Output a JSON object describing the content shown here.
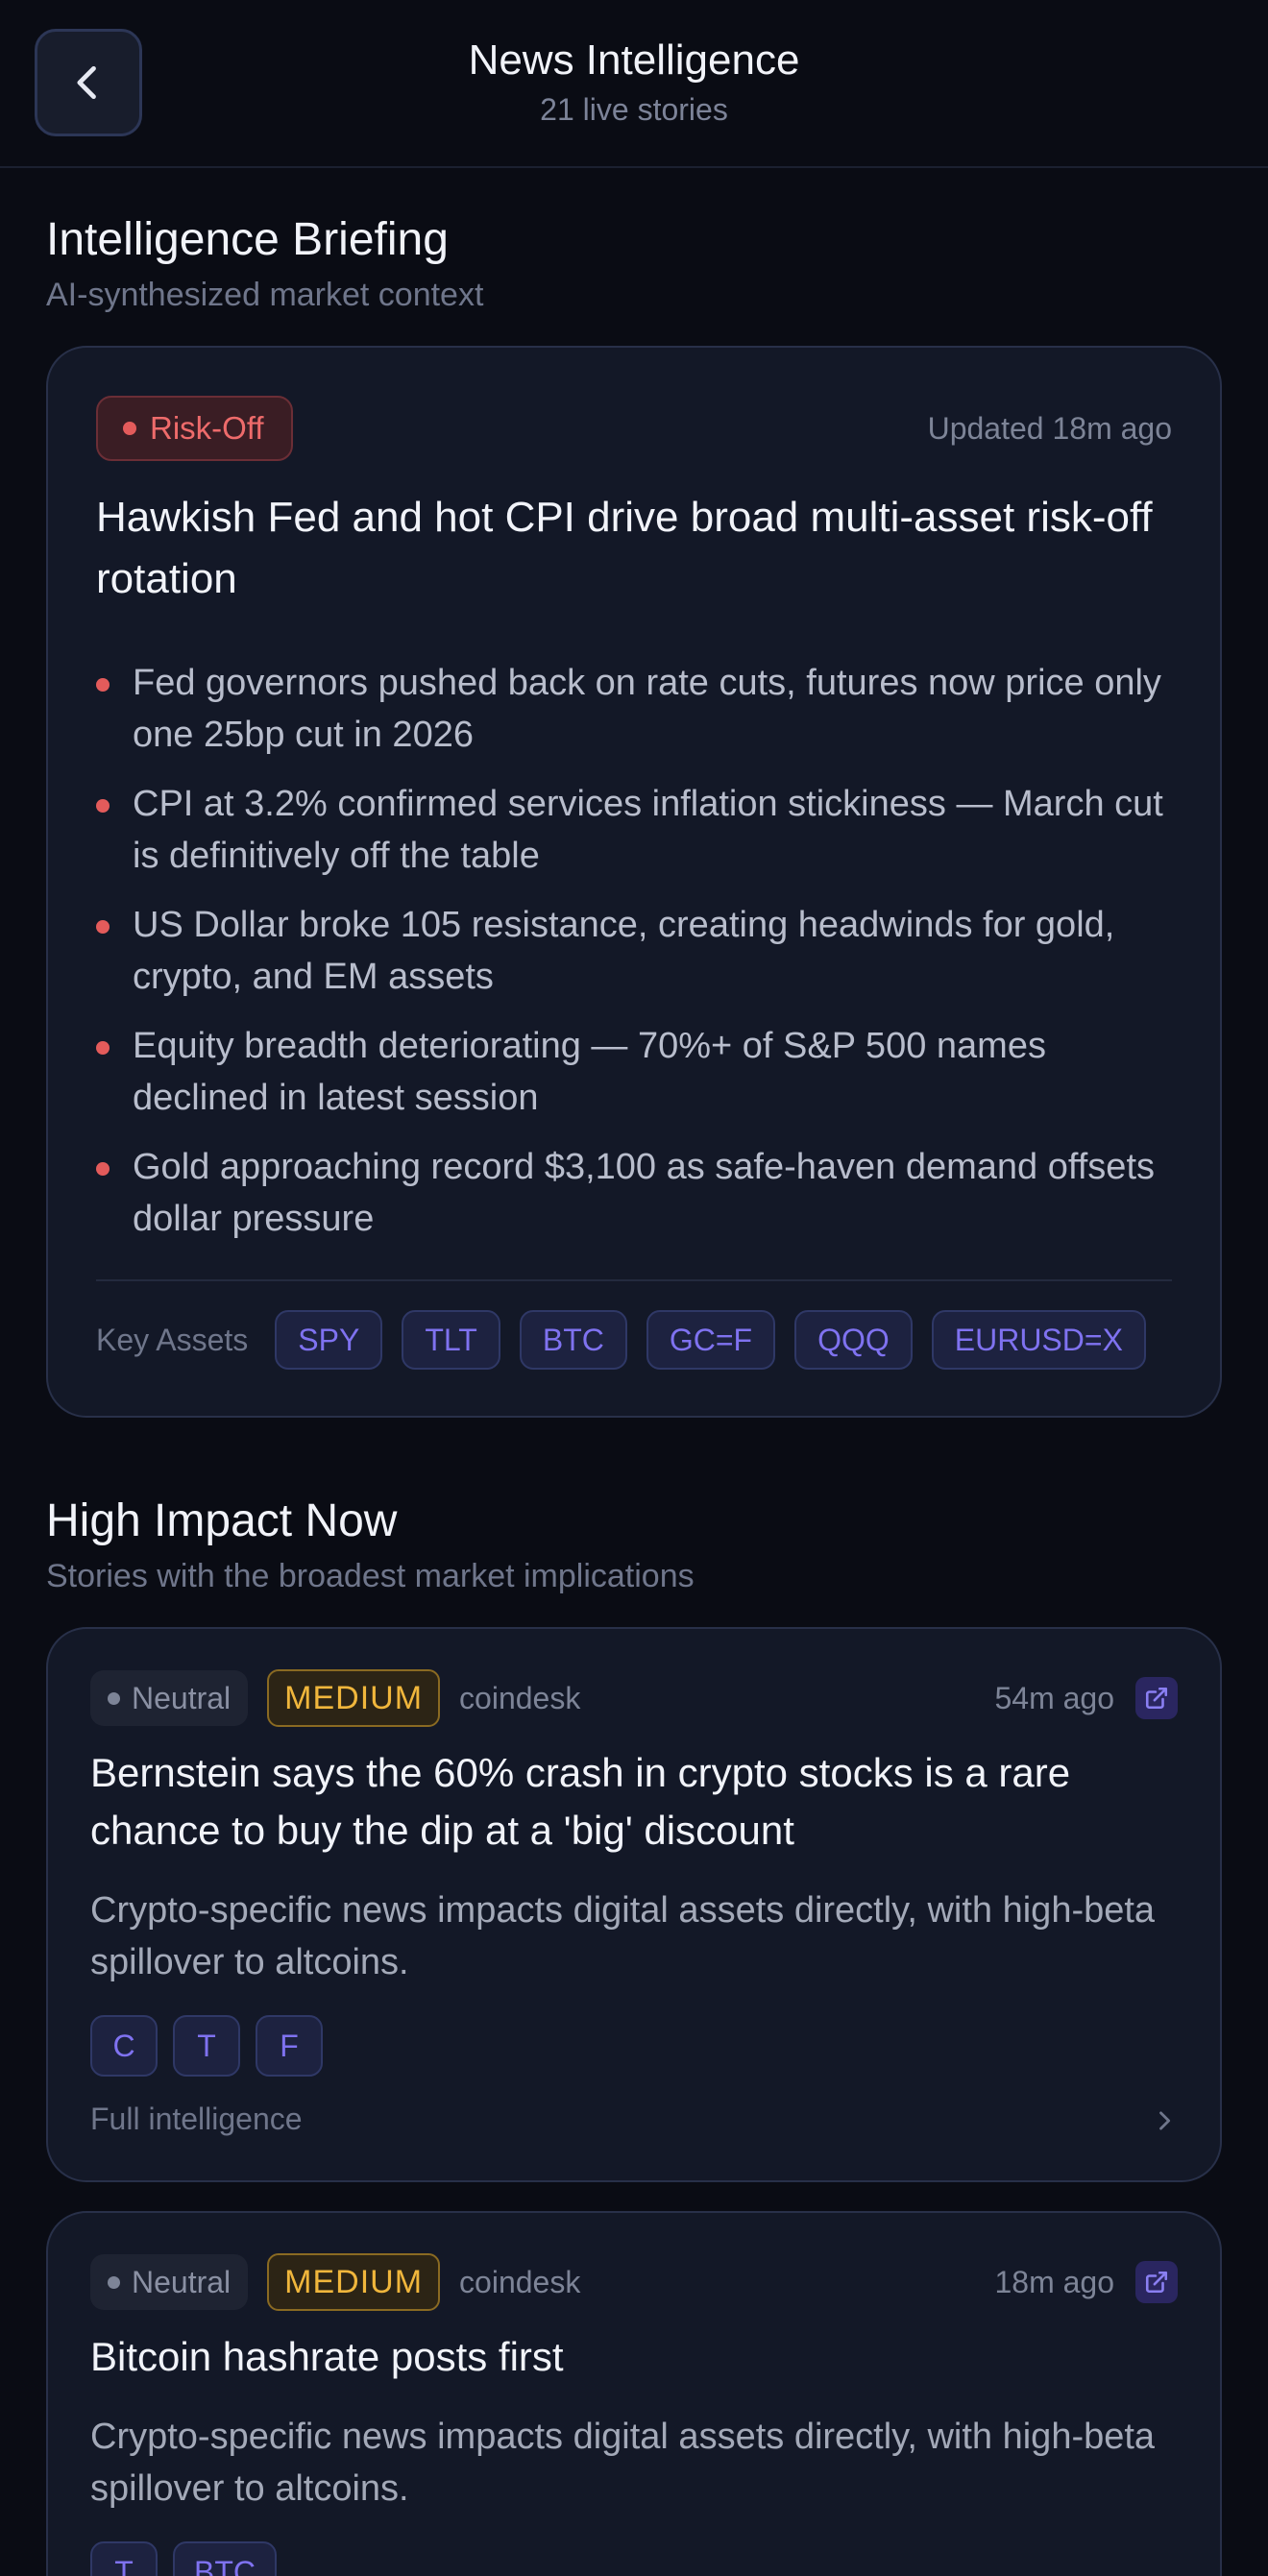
{
  "header": {
    "title": "News Intelligence",
    "subtitle": "21 live stories"
  },
  "briefing": {
    "section_title": "Intelligence Briefing",
    "section_subtitle": "AI-synthesized market context",
    "regime_label": "Risk-Off",
    "updated": "Updated 18m ago",
    "headline": "Hawkish Fed and hot CPI drive broad multi-asset risk-off rotation",
    "bullets": [
      "Fed governors pushed back on rate cuts, futures now price only one 25bp cut in 2026",
      "CPI at 3.2% confirmed services inflation stickiness — March cut is definitively off the table",
      "US Dollar broke 105 resistance, creating headwinds for gold, crypto, and EM assets",
      "Equity breadth deteriorating — 70%+ of S&P 500 names declined in latest session",
      "Gold approaching record $3,100 as safe-haven demand offsets dollar pressure"
    ],
    "key_assets_label": "Key Assets",
    "key_assets": [
      "SPY",
      "TLT",
      "BTC",
      "GC=F",
      "QQQ",
      "EURUSD=X"
    ]
  },
  "high_impact": {
    "section_title": "High Impact Now",
    "section_subtitle": "Stories with the broadest market implications",
    "stories": [
      {
        "sentiment": "Neutral",
        "impact": "MEDIUM",
        "source": "coindesk",
        "time": "54m ago",
        "title": "Bernstein says the 60% crash in crypto stocks is a rare chance to buy the dip at a 'big' discount",
        "description": "Crypto-specific news impacts digital assets directly, with high-beta spillover to altcoins.",
        "tickers": [
          "C",
          "T",
          "F"
        ],
        "full_label": "Full intelligence"
      },
      {
        "sentiment": "Neutral",
        "impact": "MEDIUM",
        "source": "coindesk",
        "time": "18m ago",
        "title": "Bitcoin hashrate posts first",
        "description": "Crypto-specific news impacts digital assets directly, with high-beta spillover to altcoins.",
        "tickers": [
          "T",
          "BTC"
        ]
      }
    ]
  },
  "colors": {
    "background": "#0a0c14",
    "card": "#131827",
    "risk_off": "#e35b5b",
    "impact_medium": "#f0b63c",
    "ticker_accent": "#7f72f0"
  },
  "icons": {
    "back": "chevron-left-icon",
    "external": "external-link-icon",
    "more": "chevron-right-icon"
  }
}
